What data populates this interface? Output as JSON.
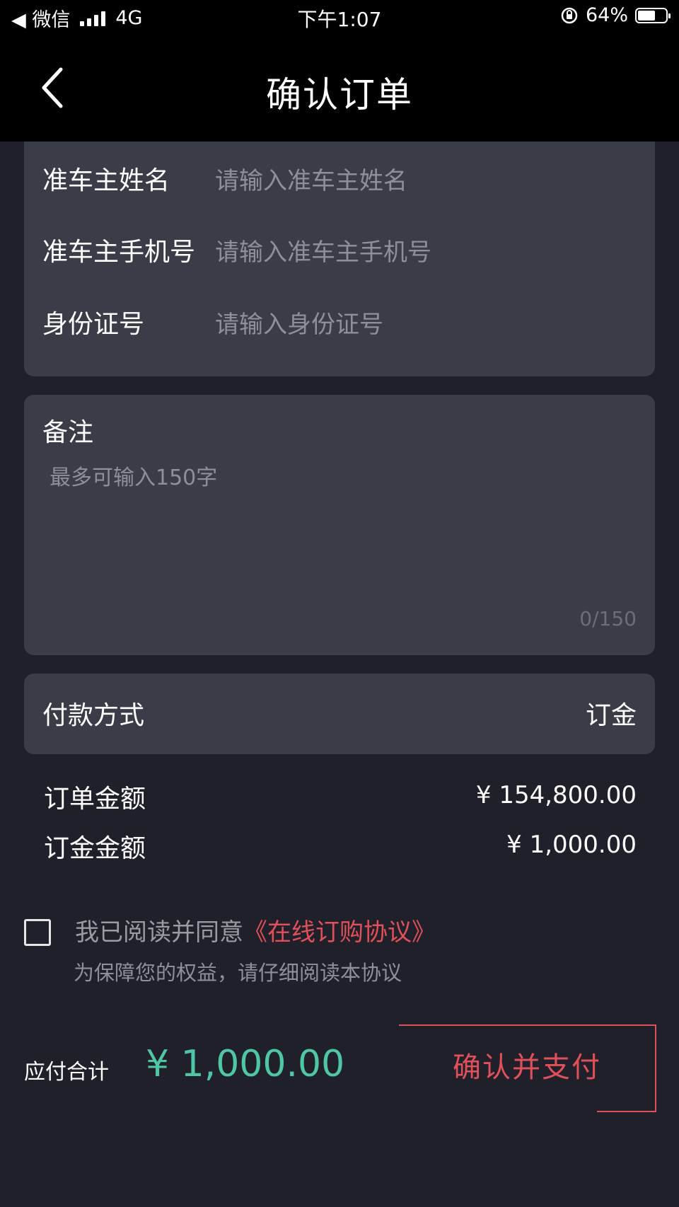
{
  "status_bar": {
    "back_app": "◀ 微信",
    "network": "4G",
    "time": "下午1:07",
    "battery_percent": "64%",
    "battery_level": 0.64
  },
  "header": {
    "title": "确认订单"
  },
  "form": {
    "name_label": "准车主姓名",
    "name_placeholder": "请输入准车主姓名",
    "phone_label": "准车主手机号",
    "phone_placeholder": "请输入准车主手机号",
    "id_label": "身份证号",
    "id_placeholder": "请输入身份证号"
  },
  "remark": {
    "label": "备注",
    "placeholder": "最多可输入150字",
    "counter": "0/150"
  },
  "payment": {
    "label": "付款方式",
    "value": "订金"
  },
  "amounts": {
    "order_label": "订单金额",
    "order_value": "¥ 154,800.00",
    "deposit_label": "订金金额",
    "deposit_value": "¥ 1,000.00"
  },
  "agreement": {
    "text": "我已阅读并同意",
    "link": "《在线订购协议》",
    "subtext": "为保障您的权益，请仔细阅读本协议",
    "checked": false
  },
  "footer": {
    "total_label": "应付合计",
    "total_value": "¥ 1,000.00",
    "confirm_label": "确认并支付"
  },
  "colors": {
    "background": "#1f2029",
    "card": "#3a3c47",
    "accent_red": "#e0505a",
    "accent_green": "#4fc6a6"
  }
}
